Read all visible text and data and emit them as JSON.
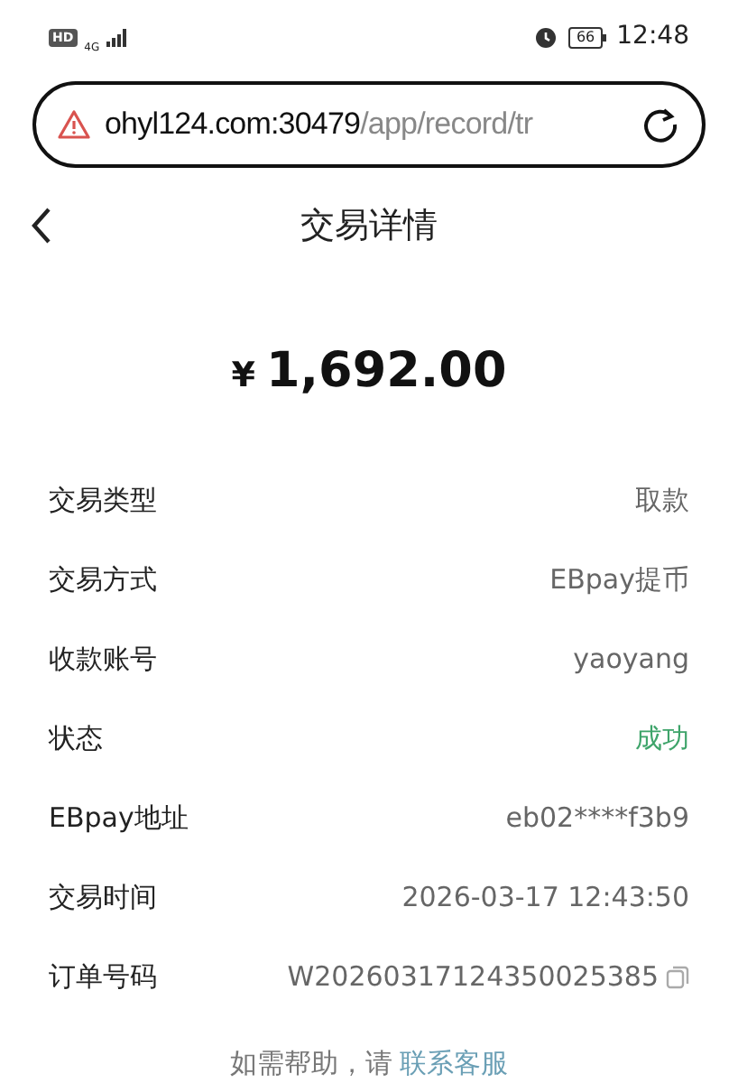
{
  "status_bar": {
    "badge": "HD",
    "network": "4G",
    "battery": "66",
    "time": "12:48"
  },
  "address_bar": {
    "host": "ohyl124.com:30479",
    "path": "/app/record/tr"
  },
  "header": {
    "title": "交易详情"
  },
  "amount": {
    "currency": "¥",
    "value": "1,692.00"
  },
  "details": [
    {
      "label": "交易类型",
      "value": "取款",
      "kind": "text"
    },
    {
      "label": "交易方式",
      "value": "EBpay提币",
      "kind": "text"
    },
    {
      "label": "收款账号",
      "value": "yaoyang",
      "kind": "text"
    },
    {
      "label": "状态",
      "value": "成功",
      "kind": "status"
    },
    {
      "label": "EBpay地址",
      "value": "eb02****f3b9",
      "kind": "text"
    },
    {
      "label": "交易时间",
      "value": "2026-03-17 12:43:50",
      "kind": "text"
    },
    {
      "label": "订单号码",
      "value": "W20260317124350025385",
      "kind": "copyable"
    }
  ],
  "footer": {
    "text": "如需帮助，请",
    "link": "联系客服"
  }
}
